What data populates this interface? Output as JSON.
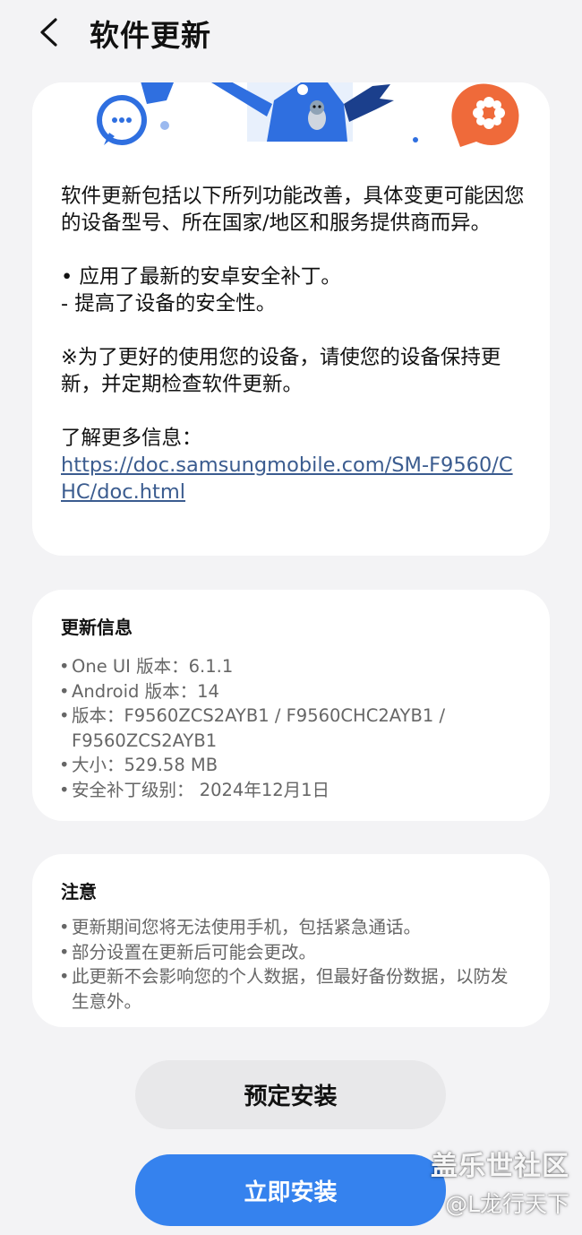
{
  "header": {
    "back_icon": "chevron-left-icon",
    "title": "软件更新"
  },
  "description": {
    "intro": "软件更新包括以下所列功能改善，具体变更可能因您的设备型号、所在国家/地区和服务提供商而异。",
    "bullet": "• 应用了最新的安卓安全补丁。",
    "sub_bullet": " - 提高了设备的安全性。",
    "note": "※为了更好的使用您的设备，请使您的设备保持更新，并定期检查软件更新。",
    "learn_more": "了解更多信息：",
    "link": "https://doc.samsungmobile.com/SM-F9560/CHC/doc.html"
  },
  "update_info": {
    "title": "更新信息",
    "items": [
      "One UI 版本：6.1.1",
      "Android 版本：14",
      "版本：F9560ZCS2AYB1 / F9560CHC2AYB1 / F9560ZCS2AYB1",
      "大小：529.58 MB",
      "安全补丁级别： 2024年12月1日"
    ]
  },
  "notice": {
    "title": "注意",
    "items": [
      "更新期间您将无法使用手机，包括紧急通话。",
      "部分设置在更新后可能会更改。",
      "此更新不会影响您的个人数据，但最好备份数据，以防发生意外。"
    ]
  },
  "buttons": {
    "schedule_install": "预定安装",
    "install_now": "立即安装"
  },
  "watermark": {
    "line1": "盖乐世社区",
    "line2": "@L龙行天下"
  },
  "colors": {
    "accent": "#3582ee",
    "link": "#3b5c8f",
    "banner_blue": "#2f6fe0",
    "banner_orange": "#ef6a3a"
  }
}
